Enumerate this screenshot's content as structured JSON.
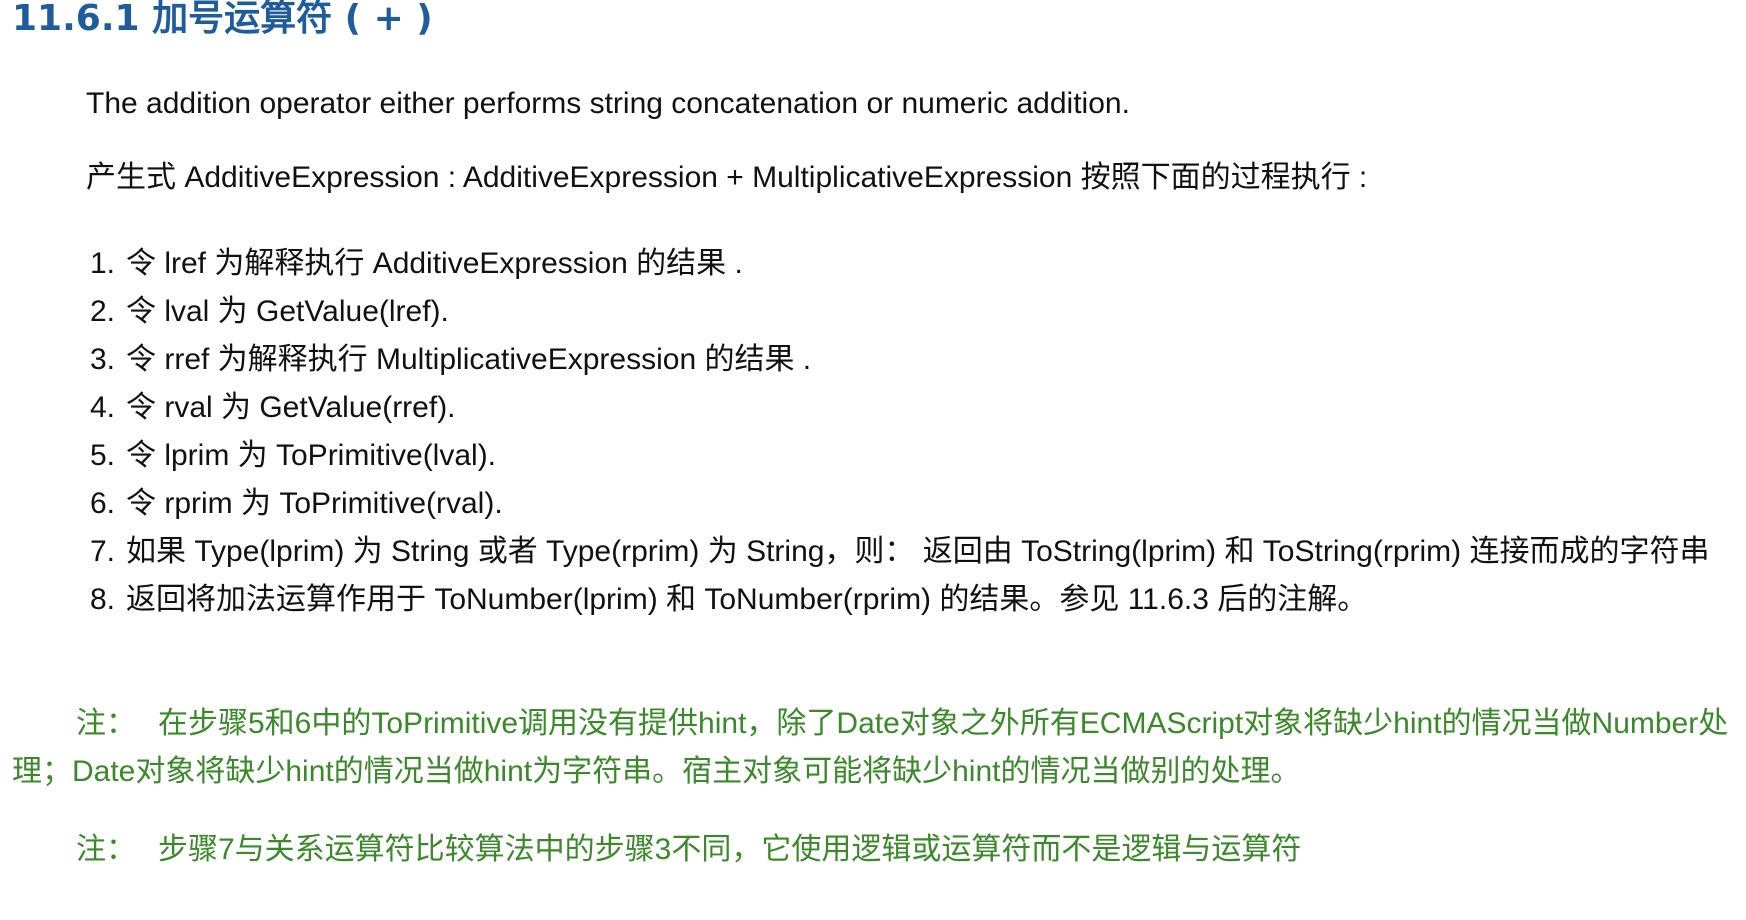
{
  "heading": "11.6.1 加号运算符 ( + )",
  "intro": "The addition operator either performs string concatenation or numeric addition.",
  "production": "产生式 AdditiveExpression : AdditiveExpression + MultiplicativeExpression 按照下面的过程执行 :",
  "steps": [
    {
      "num": "1.",
      "text": "令 lref 为解释执行 AdditiveExpression 的结果 ."
    },
    {
      "num": "2.",
      "text": "令 lval 为 GetValue(lref)."
    },
    {
      "num": "3.",
      "text": "令 rref 为解释执行 MultiplicativeExpression 的结果 ."
    },
    {
      "num": "4.",
      "text": "令 rval 为 GetValue(rref)."
    },
    {
      "num": "5.",
      "text": "令 lprim 为 ToPrimitive(lval)."
    },
    {
      "num": "6.",
      "text": "令 rprim 为 ToPrimitive(rval)."
    },
    {
      "num": "7.",
      "text": "如果 Type(lprim) 为 String 或者 Type(rprim) 为 String，则：  返回由 ToString(lprim) 和 ToString(rprim) 连接而成的字符串"
    },
    {
      "num": "8.",
      "text": "返回将加法运算作用于 ToNumber(lprim) 和 ToNumber(rprim) 的结果。参见 11.6.3 后的注解。"
    }
  ],
  "notes": [
    {
      "label": "注：",
      "text": "在步骤5和6中的ToPrimitive调用没有提供hint，除了Date对象之外所有ECMAScript对象将缺少hint的情况当做Number处理；Date对象将缺少hint的情况当做hint为字符串。宿主对象可能将缺少hint的情况当做别的处理。"
    },
    {
      "label": "注：",
      "text": "步骤7与关系运算符比较算法中的步骤3不同，它使用逻辑或运算符而不是逻辑与运算符"
    }
  ],
  "colors": {
    "heading": "#1f5c9e",
    "note": "#3a8a2a",
    "body_text": "#111111"
  }
}
